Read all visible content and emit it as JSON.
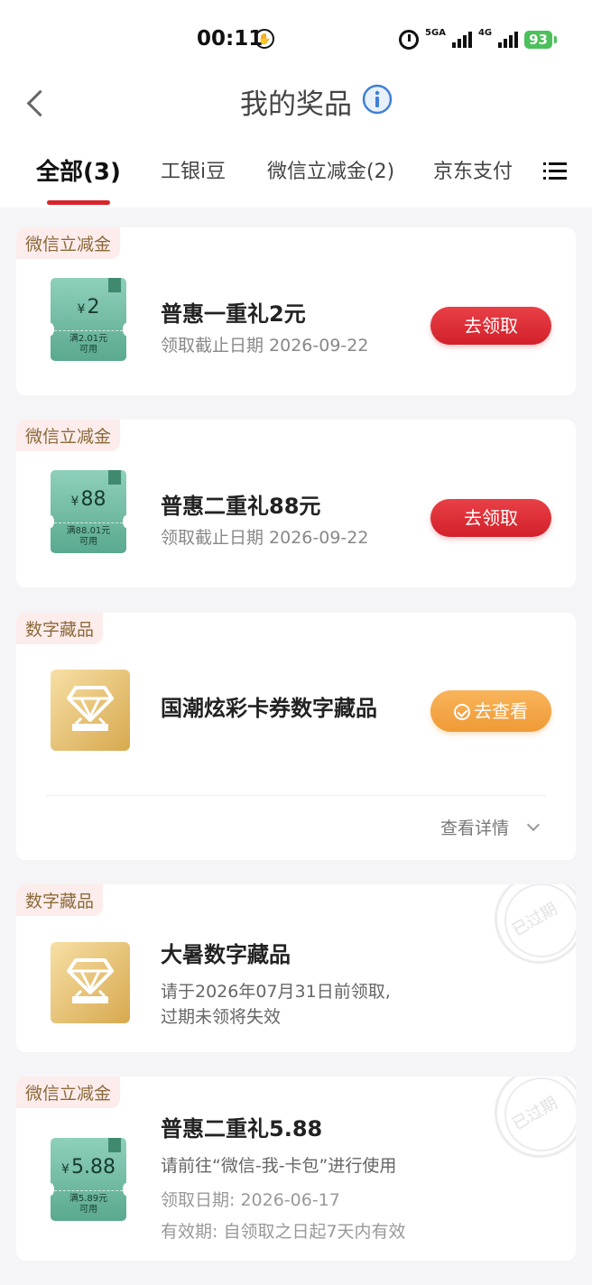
{
  "status_bar": {
    "time": "00:11",
    "net1": "5GA",
    "net2": "4G",
    "battery": "93"
  },
  "header": {
    "title": "我的奖品"
  },
  "tabs": [
    {
      "label": "全部(3)",
      "active": true
    },
    {
      "label": "工银i豆",
      "active": false
    },
    {
      "label": "微信立减金(2)",
      "active": false
    },
    {
      "label": "京东支付",
      "active": false
    }
  ],
  "prizes": [
    {
      "tag": "微信立减金",
      "coupon_currency": "¥",
      "coupon_amount": "2",
      "coupon_condition": "满2.01元",
      "coupon_usable": "可用",
      "title": "普惠一重礼2元",
      "subtitle": "领取截止日期 2026-09-22",
      "action": "去领取"
    },
    {
      "tag": "微信立减金",
      "coupon_currency": "¥",
      "coupon_amount": "88",
      "coupon_condition": "满88.01元",
      "coupon_usable": "可用",
      "title": "普惠二重礼88元",
      "subtitle": "领取截止日期 2026-09-22",
      "action": "去领取"
    },
    {
      "tag": "数字藏品",
      "title": "国潮炫彩卡券数字藏品",
      "action": "去查看",
      "details": "查看详情"
    },
    {
      "tag": "数字藏品",
      "title": "大暑数字藏品",
      "line1": "请于2026年07月31日前领取,",
      "line2": "过期未领将失效",
      "stamp": "已过期"
    },
    {
      "tag": "微信立减金",
      "coupon_currency": "¥",
      "coupon_amount": "5.88",
      "coupon_condition": "满5.89元",
      "coupon_usable": "可用",
      "title": "普惠二重礼5.88",
      "line1": "请前往“微信-我-卡包”进行使用",
      "line2": "领取日期: 2026-06-17",
      "line3": "有效期: 自领取之日起7天内有效",
      "stamp": "已过期"
    }
  ],
  "colors": {
    "accent_red": "#d8252c",
    "orange_button": "#f09a36",
    "coupon_green": "#5aa98f",
    "collectible_gold": "#d7a94f"
  }
}
